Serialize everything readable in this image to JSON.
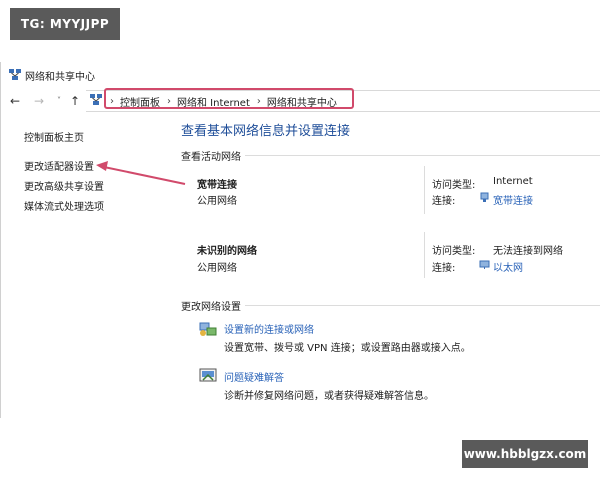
{
  "watermarks": {
    "top_left": "TG: MYYJJPP",
    "bottom_right": "www.hbblgzx.com"
  },
  "window": {
    "title": "网络和共享中心"
  },
  "nav": {
    "back": "←",
    "forward": "→",
    "dropdown": "˅",
    "up": "↑"
  },
  "address": {
    "breadcrumbs": [
      "控制面板",
      "网络和 Internet",
      "网络和共享中心"
    ],
    "separator": "›"
  },
  "sidebar": {
    "items": [
      {
        "label": "控制面板主页"
      },
      {
        "label": "更改适配器设置"
      },
      {
        "label": "更改高级共享设置"
      },
      {
        "label": "媒体流式处理选项"
      }
    ]
  },
  "main": {
    "title": "查看基本网络信息并设置连接",
    "active_section": "查看活动网络",
    "networks": [
      {
        "name": "宽带连接",
        "category": "公用网络",
        "access_label": "访问类型:",
        "access_value": "Internet",
        "conn_label": "连接:",
        "conn_value": "宽带连接",
        "conn_icon": "broadband-icon"
      },
      {
        "name": "未识别的网络",
        "category": "公用网络",
        "access_label": "访问类型:",
        "access_value": "无法连接到网络",
        "conn_label": "连接:",
        "conn_value": "以太网",
        "conn_icon": "ethernet-icon"
      }
    ],
    "change_section": "更改网络设置",
    "tasks": [
      {
        "link": "设置新的连接或网络",
        "desc": "设置宽带、拨号或 VPN 连接；或设置路由器或接入点。",
        "icon": "new-connection-icon"
      },
      {
        "link": "问题疑难解答",
        "desc": "诊断并修复网络问题，或者获得疑难解答信息。",
        "icon": "troubleshoot-icon"
      }
    ]
  },
  "colors": {
    "link": "#2a63b8",
    "title": "#1f4e99",
    "highlight": "#d14a6b",
    "watermark_bg": "#5a5a5a"
  }
}
